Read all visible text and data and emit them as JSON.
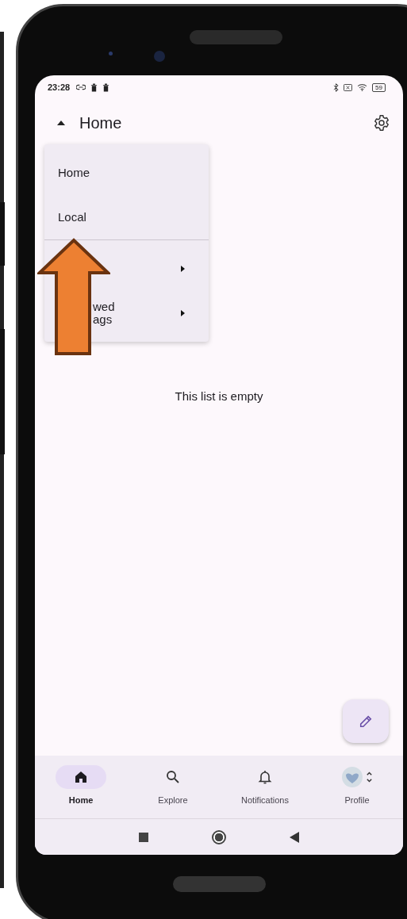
{
  "status_bar": {
    "time": "23:28",
    "battery": "59"
  },
  "app_bar": {
    "title": "Home",
    "expanded": true
  },
  "dropdown_menu": {
    "items": [
      {
        "kind": "plain",
        "lines": [
          "Home"
        ]
      },
      {
        "kind": "plain",
        "lines": [
          "Local"
        ]
      },
      {
        "kind": "submenu"
      },
      {
        "kind": "submenu",
        "lines": [
          "wed",
          "ags"
        ]
      }
    ]
  },
  "empty_message": "This list is empty",
  "bottom_nav": [
    {
      "kind": "home",
      "label": "Home",
      "selected": true
    },
    {
      "kind": "search",
      "label": "Explore",
      "selected": false
    },
    {
      "kind": "bell",
      "label": "Notifications",
      "selected": false
    },
    {
      "kind": "profile",
      "label": "Profile",
      "selected": false
    }
  ]
}
